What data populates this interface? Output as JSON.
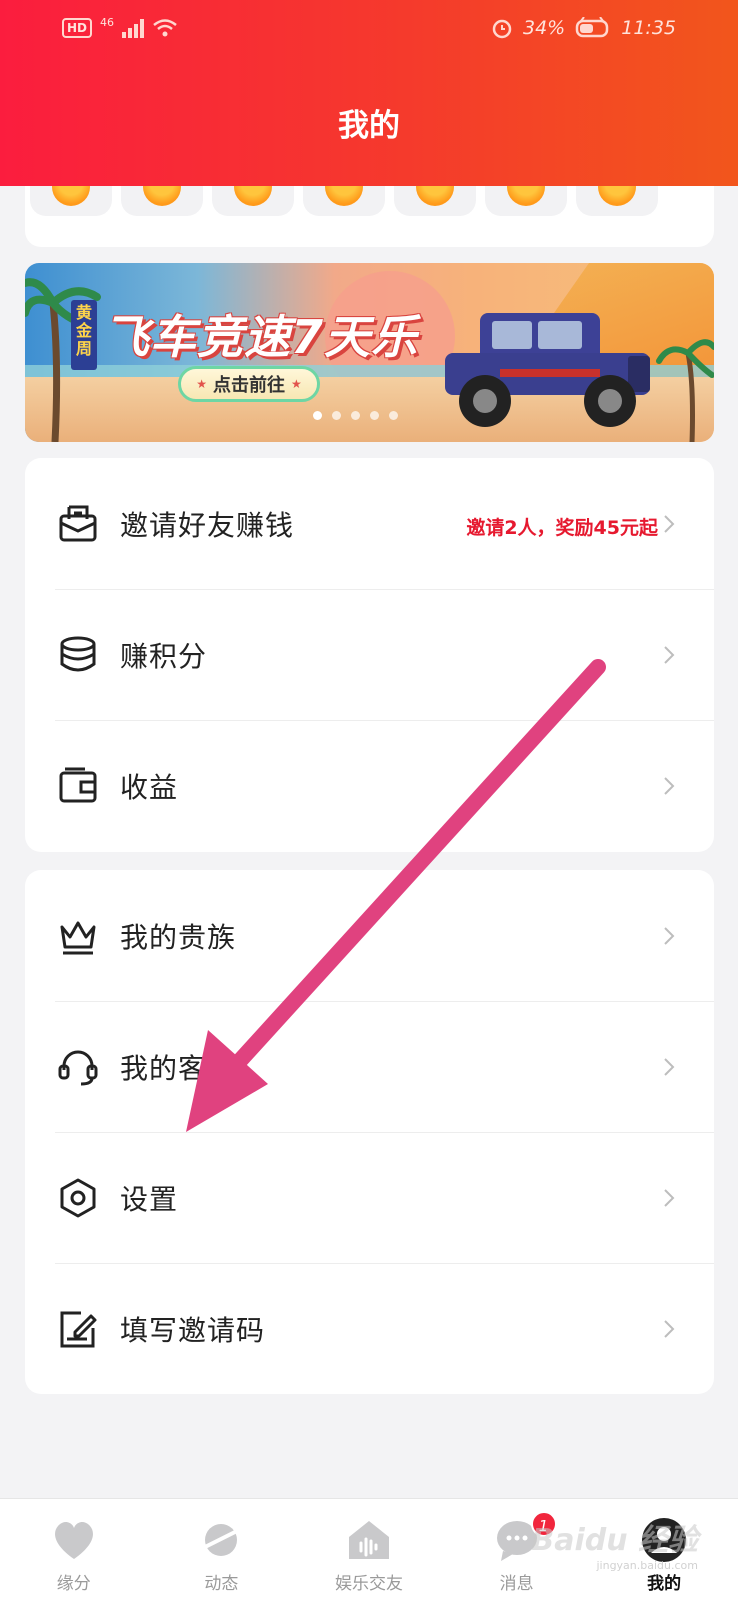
{
  "status_bar": {
    "hd": "HD",
    "network": "46",
    "battery": "34%",
    "time": "11:35"
  },
  "header": {
    "title": "我的"
  },
  "banner": {
    "tag": "黄金周",
    "title": "飞车竞速7天乐",
    "button": "点击前往",
    "active_dot": 0,
    "dot_count": 5
  },
  "menu_group_1": [
    {
      "label": "邀请好友赚钱",
      "subtitle": "邀请2人，奖励45元起",
      "icon": "envelope-icon"
    },
    {
      "label": "赚积分",
      "icon": "coins-stack-icon"
    },
    {
      "label": "收益",
      "icon": "wallet-icon"
    }
  ],
  "menu_group_2": [
    {
      "label": "我的贵族",
      "icon": "crown-icon"
    },
    {
      "label": "我的客服",
      "icon": "headset-icon"
    },
    {
      "label": "设置",
      "icon": "hexagon-settings-icon"
    },
    {
      "label": "填写邀请码",
      "icon": "edit-note-icon"
    }
  ],
  "bottom_nav": [
    {
      "label": "缘分",
      "icon": "heart-icon"
    },
    {
      "label": "动态",
      "icon": "planet-icon"
    },
    {
      "label": "娱乐交友",
      "icon": "house-voice-icon"
    },
    {
      "label": "消息",
      "icon": "chat-bubble-icon",
      "badge": "1"
    },
    {
      "label": "我的",
      "icon": "person-icon",
      "active": true
    }
  ],
  "watermark": {
    "text": "Baidu 经验",
    "sub": "jingyan.baidu.com"
  },
  "colors": {
    "header_start": "#fb1d3e",
    "header_end": "#f2561c",
    "accent_red": "#e6192f",
    "arrow": "#e0427f"
  }
}
